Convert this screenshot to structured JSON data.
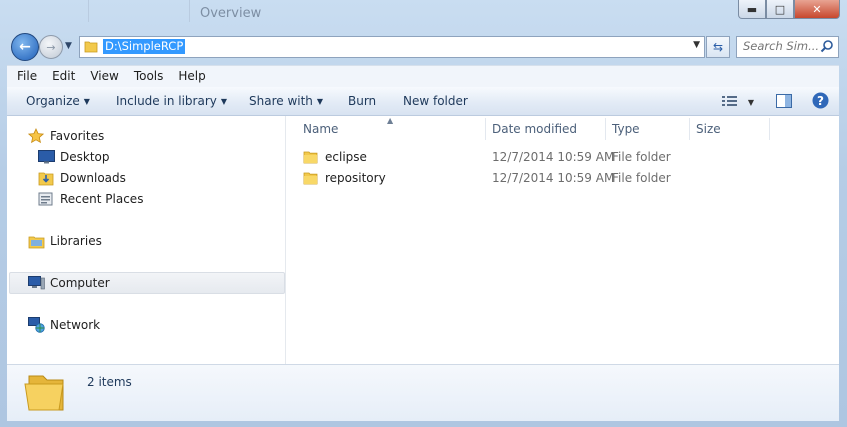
{
  "window": {
    "background_title": "Overview",
    "buttons": {
      "minimize": "▬",
      "maximize": "□",
      "close": "✕"
    }
  },
  "navigation": {
    "address": "D:\\SimpleRCP",
    "search_placeholder": "Search Sim..."
  },
  "menubar": {
    "items": [
      "File",
      "Edit",
      "View",
      "Tools",
      "Help"
    ]
  },
  "toolbar": {
    "organize": "Organize",
    "include_in_library": "Include in library",
    "share_with": "Share with",
    "burn": "Burn",
    "new_folder": "New folder"
  },
  "nav_pane": {
    "favorites": "Favorites",
    "desktop": "Desktop",
    "downloads": "Downloads",
    "recent_places": "Recent Places",
    "libraries": "Libraries",
    "computer": "Computer",
    "network": "Network"
  },
  "file_list": {
    "columns": [
      "Name",
      "Date modified",
      "Type",
      "Size"
    ],
    "rows": [
      {
        "name": "eclipse",
        "date": "12/7/2014 10:59 AM",
        "type": "File folder",
        "size": ""
      },
      {
        "name": "repository",
        "date": "12/7/2014 10:59 AM",
        "type": "File folder",
        "size": ""
      }
    ]
  },
  "details": {
    "count": "2 items"
  },
  "colors": {
    "accent": "#3399ff",
    "folder": "#f2c94c",
    "chrome": "#b9cfe8"
  }
}
